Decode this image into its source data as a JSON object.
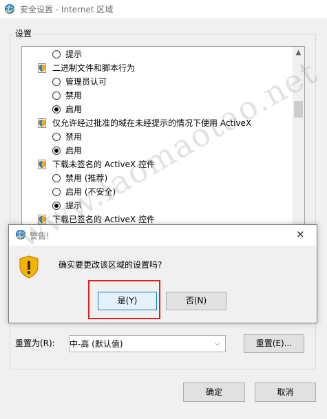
{
  "window": {
    "title": "安全设置 - Internet 区域"
  },
  "settings_group": {
    "label": "设置",
    "rows": [
      {
        "kind": "radio",
        "label": "提示",
        "checked": false
      },
      {
        "kind": "category",
        "label": "二进制文件和脚本行为"
      },
      {
        "kind": "radio",
        "label": "管理员认可",
        "checked": false
      },
      {
        "kind": "radio",
        "label": "禁用",
        "checked": false
      },
      {
        "kind": "radio",
        "label": "启用",
        "checked": true
      },
      {
        "kind": "category",
        "label": "仅允许经过批准的域在未经提示的情况下使用 ActiveX"
      },
      {
        "kind": "radio",
        "label": "禁用",
        "checked": false
      },
      {
        "kind": "radio",
        "label": "启用",
        "checked": true
      },
      {
        "kind": "category",
        "label": "下载未签名的 ActiveX 控件"
      },
      {
        "kind": "radio",
        "label": "禁用 (推荐)",
        "checked": false
      },
      {
        "kind": "radio",
        "label": "启用 (不安全)",
        "checked": false
      },
      {
        "kind": "radio",
        "label": "提示",
        "checked": true
      },
      {
        "kind": "category",
        "label": "下载已签名的 ActiveX 控件"
      }
    ]
  },
  "reset": {
    "label": "重置为(R):",
    "selected": "中-高 (默认值)",
    "button": "重置(E)..."
  },
  "footer": {
    "ok": "确定",
    "cancel": "取消"
  },
  "dialog": {
    "title": "警告!",
    "message": "确实要更改该区域的设置吗?",
    "yes": "是(Y)",
    "no": "否(N)",
    "close": "✕"
  },
  "watermark": "www.laomaotao.net",
  "colors": {
    "highlight_box": "#e02020",
    "default_button_border": "#0078d7"
  }
}
